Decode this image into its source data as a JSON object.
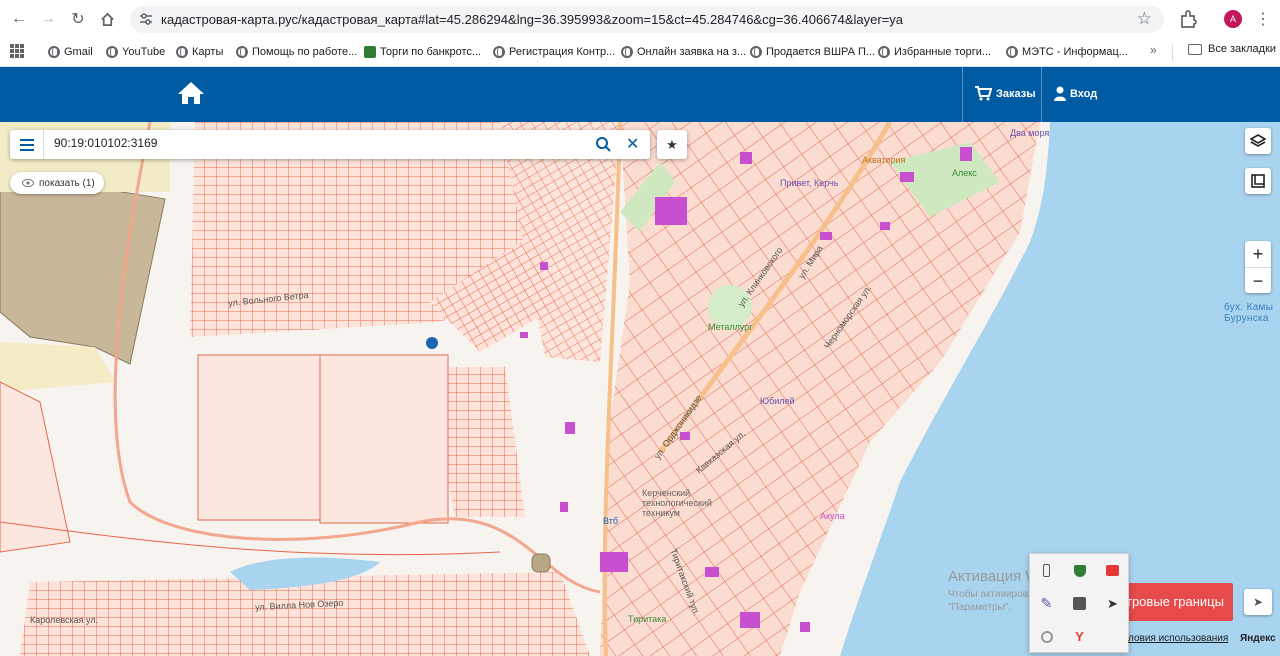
{
  "browser": {
    "url": "кадастровая-карта.рус/кадастровая_карта#lat=45.286294&lng=36.395993&zoom=15&ct=45.284746&cg=36.406674&layer=ya",
    "avatar_letter": "A",
    "bookmarks": [
      {
        "label": "Gmail",
        "icon": "gmail-icon"
      },
      {
        "label": "YouTube",
        "icon": "youtube-icon"
      },
      {
        "label": "Карты",
        "icon": "globe-icon"
      },
      {
        "label": "Помощь по работе...",
        "icon": "globe-icon"
      },
      {
        "label": "Торги по банкротс...",
        "icon": "hammer-icon"
      },
      {
        "label": "Регистрация Контр...",
        "icon": "globe-icon"
      },
      {
        "label": "Онлайн заявка на з...",
        "icon": "globe-icon"
      },
      {
        "label": "Продается ВШРА П...",
        "icon": "globe-icon"
      },
      {
        "label": "Избранные торги...",
        "icon": "globe-icon"
      },
      {
        "label": "МЭТС - Информац...",
        "icon": "globe-icon"
      }
    ],
    "bookmarks_more": "»",
    "all_bookmarks": "Все закладки"
  },
  "header": {
    "orders_label": "Заказы",
    "login_label": "Вход",
    "bg_color": "#005ba2"
  },
  "map_ui": {
    "search_value": "90:19:010102:3169",
    "show_button_label": "показать (1)",
    "red_button_label": "тровые границы",
    "zoom_in": "+",
    "zoom_out": "−",
    "terms_label": "ловия использования",
    "provider_label": "Яндекс"
  },
  "windows": {
    "activate_title": "Активация Windows",
    "activate_text_1": "Чтобы активировать Windows, перейдите в раздел",
    "activate_text_2": "\"Параметры\"."
  },
  "map_labels": {
    "street_volny": "ул. Вольного Ветра",
    "street_mira": "ул. Мира",
    "street_klinkova": "ул. Клинковского",
    "street_chernomorskaya": "Черноморская ул.",
    "street_ordzhonikidze": "ул. Орджоникидзе",
    "street_kavkazskaya": "Кавказская ул.",
    "street_tiritaksky": "Тиритакский туп.",
    "street_karolevskaya": "Каролевская ул.",
    "street_vtoraya": "ул. Вилла Нов Озеро",
    "poi_metallurg": "Металлург",
    "poi_yubileyny": "Юбилей",
    "poi_akvatoria": "Акватория",
    "poi_privet_kerch": "Привет, Керчь",
    "poi_dva_morya": "Два моря",
    "poi_aleks": "Алекс",
    "poi_tehnikum": "Керченский технологический техникум",
    "poi_tiritaka": "Тиритака",
    "poi_vtb": "Втб",
    "poi_akula": "Акула",
    "bay_line1": "бух. Камы",
    "bay_line2": "Бурунска"
  }
}
